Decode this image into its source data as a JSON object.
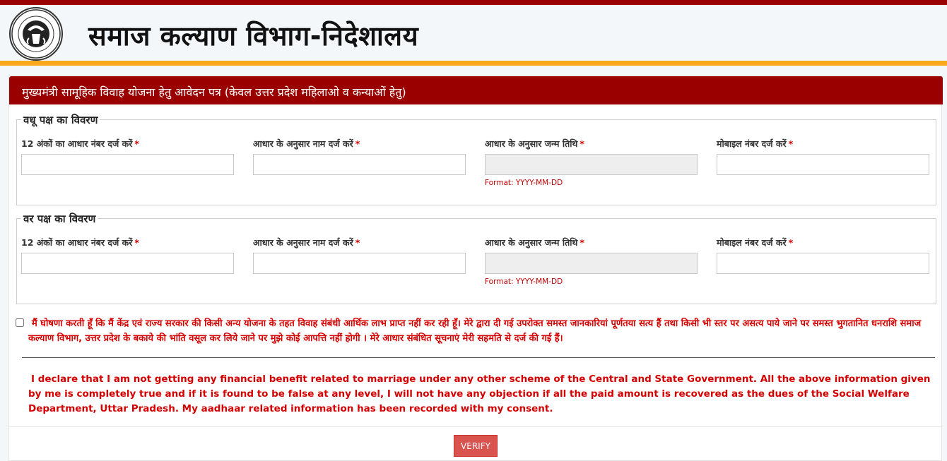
{
  "header": {
    "title": "समाज कल्याण विभाग-निदेशालय",
    "logo_text": "GOVERNMENT OF UTTAR PRADESH"
  },
  "form": {
    "title": "मुख्यमंत्री सामूहिक विवाह योजना हेतु आवेदन पत्र (केवल उत्तर प्रदेश महिलाओ व कन्याओं हेतु)",
    "bride": {
      "legend": "वधू पक्ष का विवरण",
      "aadhaar_label": "12 अंकों का आधार नंबर दर्ज करें",
      "aadhaar_value": "",
      "name_label": "आधार के अनुसार नाम दर्ज करें",
      "name_value": "",
      "dob_label": "आधार के अनुसार जन्म तिथि",
      "dob_value": "",
      "dob_help": "Format: YYYY-MM-DD",
      "mobile_label": "मोबाइल नंबर दर्ज करें",
      "mobile_value": ""
    },
    "groom": {
      "legend": "वर पक्ष का विवरण",
      "aadhaar_label": "12 अंकों का आधार नंबर दर्ज करें",
      "aadhaar_value": "",
      "name_label": "आधार के अनुसार नाम दर्ज करें",
      "name_value": "",
      "dob_label": "आधार के अनुसार जन्म तिथि",
      "dob_value": "",
      "dob_help": "Format: YYYY-MM-DD",
      "mobile_label": "मोबाइल नंबर दर्ज करें",
      "mobile_value": ""
    },
    "required_mark": "*",
    "declaration_hi": "मैं घोषणा करती हूँ कि मैं केंद्र एवं राज्य सरकार की किसी अन्य योजना के तहत विवाह संबंधी आर्थिक लाभ प्राप्त नहीं कर रही हूँ। मेरे द्वारा दी गई उपरोक्त समस्त जानकारियां पूर्णतया सत्य हैं तथा किसी भी स्तर पर असत्य पाये जाने पर समस्त भुगतानित धनराशि समाज कल्याण विभाग, उत्तर प्रदेश के बकाये की भांति वसूल कर लिये जाने पर मुझे कोई आपत्ति नहीं होगी । मेरे आधार संबंधित सूचनाएं मेरी सहमति से दर्ज की गई हैं।",
    "declaration_checked": false,
    "declaration_en": "I declare that I am not getting any financial benefit related to marriage under any other scheme of the Central and State Government. All the above information given by me is completely true and if it is found to be false at any level, I will not have any objection if all the paid amount is recovered as the dues of the Social Welfare Department, Uttar Pradesh. My aadhaar related information has been recorded with my consent.",
    "verify_label": "VERIFY"
  },
  "colors": {
    "brand_red": "#9b0000",
    "accent_orange": "#f7a81b",
    "error_red": "#d40000",
    "button_red": "#d9534f"
  }
}
